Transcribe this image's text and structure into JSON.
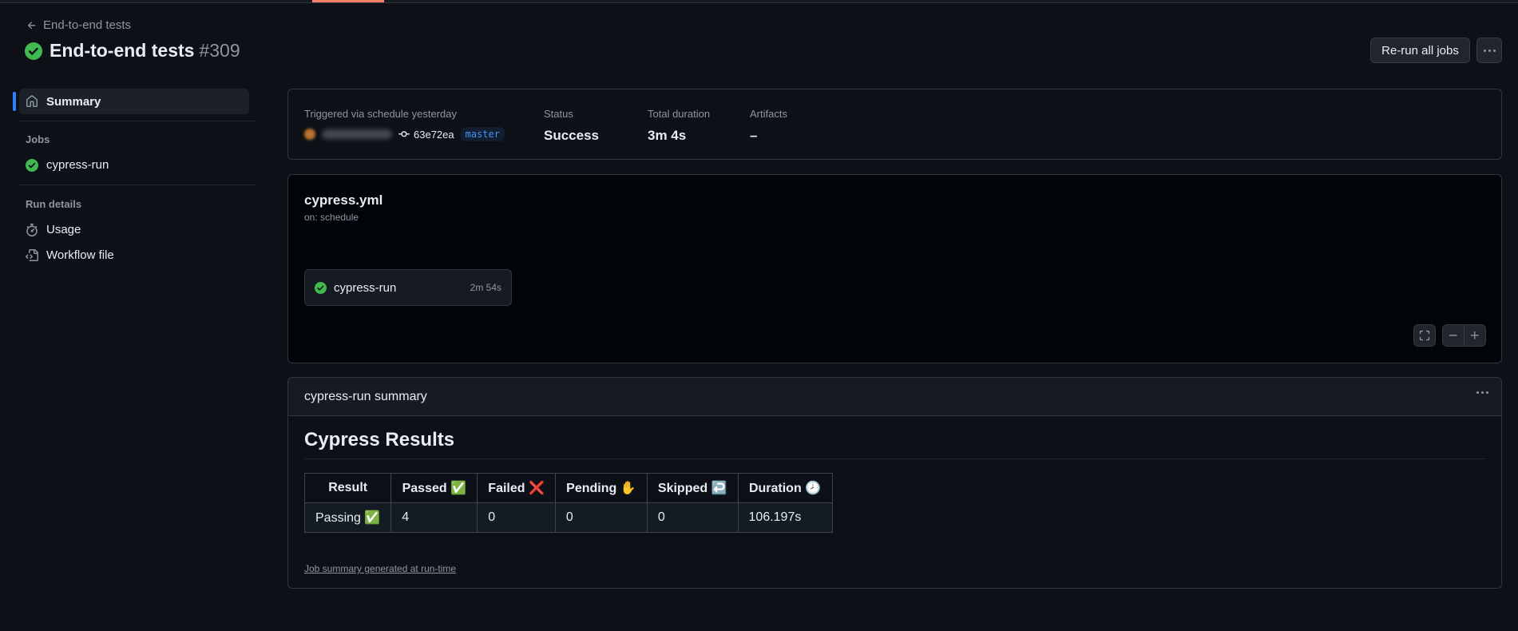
{
  "header": {
    "back_label": "End-to-end tests",
    "title": "End-to-end tests",
    "run_number": "#309",
    "rerun_label": "Re-run all jobs"
  },
  "sidebar": {
    "summary_label": "Summary",
    "jobs_heading": "Jobs",
    "jobs": [
      {
        "label": "cypress-run",
        "status": "success"
      }
    ],
    "run_details_heading": "Run details",
    "details": [
      {
        "label": "Usage",
        "icon": "stopwatch-icon"
      },
      {
        "label": "Workflow file",
        "icon": "file-code-icon"
      }
    ]
  },
  "run_info": {
    "trigger_label": "Triggered via schedule yesterday",
    "commit_sha": "63e72ea",
    "branch": "master",
    "status_label": "Status",
    "status_value": "Success",
    "duration_label": "Total duration",
    "duration_value": "3m 4s",
    "artifacts_label": "Artifacts",
    "artifacts_value": "–"
  },
  "workflow": {
    "file": "cypress.yml",
    "trigger": "on: schedule",
    "job_name": "cypress-run",
    "job_duration": "2m 54s"
  },
  "summary": {
    "header": "cypress-run summary",
    "title": "Cypress Results",
    "columns": [
      "Result",
      "Passed ✅",
      "Failed ❌",
      "Pending ✋",
      "Skipped ↩️",
      "Duration 🕗"
    ],
    "row": [
      "Passing ✅",
      "4",
      "0",
      "0",
      "0",
      "106.197s"
    ],
    "footnote": "Job summary generated at run-time"
  },
  "colors": {
    "background": "#0d1117",
    "success": "#3fb950",
    "accent": "#2f81f7",
    "branch_text": "#4493f8"
  }
}
